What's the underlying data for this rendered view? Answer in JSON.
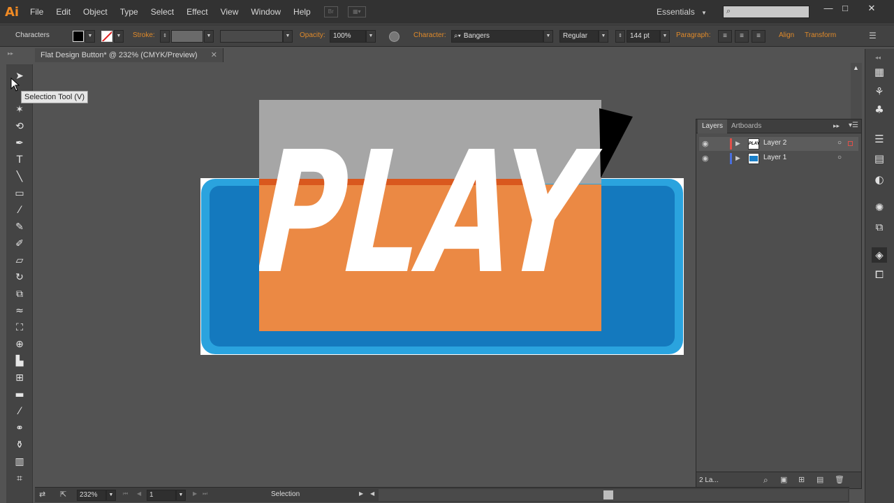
{
  "app": {
    "logo": "Ai"
  },
  "menu": [
    "File",
    "Edit",
    "Object",
    "Type",
    "Select",
    "Effect",
    "View",
    "Window",
    "Help"
  ],
  "workspace": "Essentials",
  "control_bar": {
    "selection_label": "Characters",
    "stroke_label": "Stroke:",
    "opacity_label": "Opacity:",
    "opacity_value": "100%",
    "character_label": "Character:",
    "font_name": "Bangers",
    "font_style": "Regular",
    "font_size": "144 pt",
    "paragraph_label": "Paragraph:",
    "align_label": "Align",
    "transform_label": "Transform"
  },
  "document_tab": {
    "title": "Flat Design Button* @ 232% (CMYK/Preview)"
  },
  "tooltip": "Selection Tool (V)",
  "artwork": {
    "text": "PLAY"
  },
  "layers_panel": {
    "tabs": [
      "Layers",
      "Artboards"
    ],
    "layers": [
      {
        "name": "Layer 2",
        "color": "#e0504a"
      },
      {
        "name": "Layer 1",
        "color": "#4a6fe0"
      }
    ],
    "footer_count": "2 La..."
  },
  "status_bar": {
    "zoom": "232%",
    "artboard": "1",
    "tool": "Selection"
  }
}
